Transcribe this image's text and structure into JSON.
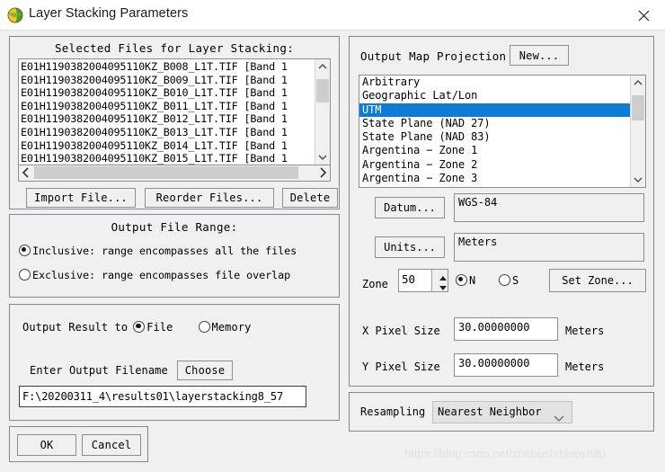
{
  "window": {
    "title": "Layer Stacking Parameters",
    "icon": "envi-globe-icon",
    "close_label": "✕"
  },
  "files_panel": {
    "title": "Selected Files for Layer Stacking:",
    "rows": [
      "E01H1190382004095110KZ_B008_L1T.TIF [Band 1",
      "E01H1190382004095110KZ_B009_L1T.TIF [Band 1",
      "E01H1190382004095110KZ_B010_L1T.TIF [Band 1",
      "E01H1190382004095110KZ_B011_L1T.TIF [Band 1",
      "E01H1190382004095110KZ_B012_L1T.TIF [Band 1",
      "E01H1190382004095110KZ_B013_L1T.TIF [Band 1",
      "E01H1190382004095110KZ_B014_L1T.TIF [Band 1",
      "E01H1190382004095110KZ_B015_L1T.TIF [Band 1"
    ],
    "buttons": {
      "import": "Import File...",
      "reorder": "Reorder Files...",
      "delete": "Delete"
    }
  },
  "range_panel": {
    "title": "Output File Range:",
    "inclusive_label": "Inclusive: range encompasses all the files",
    "exclusive_label": "Exclusive: range encompasses file overlap",
    "selected": "inclusive"
  },
  "output_panel": {
    "result_label": "Output Result to",
    "file_option": "File",
    "memory_option": "Memory",
    "selected": "file",
    "filename_label": "Enter Output Filename",
    "choose_button": "Choose",
    "filename_value": "F:\\20200311_4\\results01\\layerstacking8_57"
  },
  "actions": {
    "ok": "OK",
    "cancel": "Cancel"
  },
  "projection_panel": {
    "label": "Output Map Projection",
    "new_button": "New...",
    "items": [
      "Arbitrary",
      "Geographic Lat/Lon",
      "UTM",
      "State Plane (NAD 27)",
      "State Plane (NAD 83)",
      "Argentina − Zone 1",
      "Argentina − Zone 2",
      "Argentina − Zone 3"
    ],
    "selected_index": 2,
    "selection_color": "#0c7cd5",
    "datum_button": "Datum...",
    "datum_value": "WGS-84",
    "units_button": "Units...",
    "units_value": "Meters",
    "zone_label": "Zone",
    "zone_value": "50",
    "hemisphere_n": "N",
    "hemisphere_s": "S",
    "hemisphere_selected": "N",
    "set_zone_button": "Set Zone...",
    "x_pixel_label": "X Pixel Size",
    "x_pixel_value": "30.00000000",
    "x_pixel_units": "Meters",
    "y_pixel_label": "Y Pixel Size",
    "y_pixel_value": "30.00000000",
    "y_pixel_units": "Meters"
  },
  "resampling_panel": {
    "label": "Resampling",
    "value": "Nearest Neighbor"
  },
  "watermark": {
    "text": "https://blog.csdn.net/zhebushibiaoshifu"
  }
}
